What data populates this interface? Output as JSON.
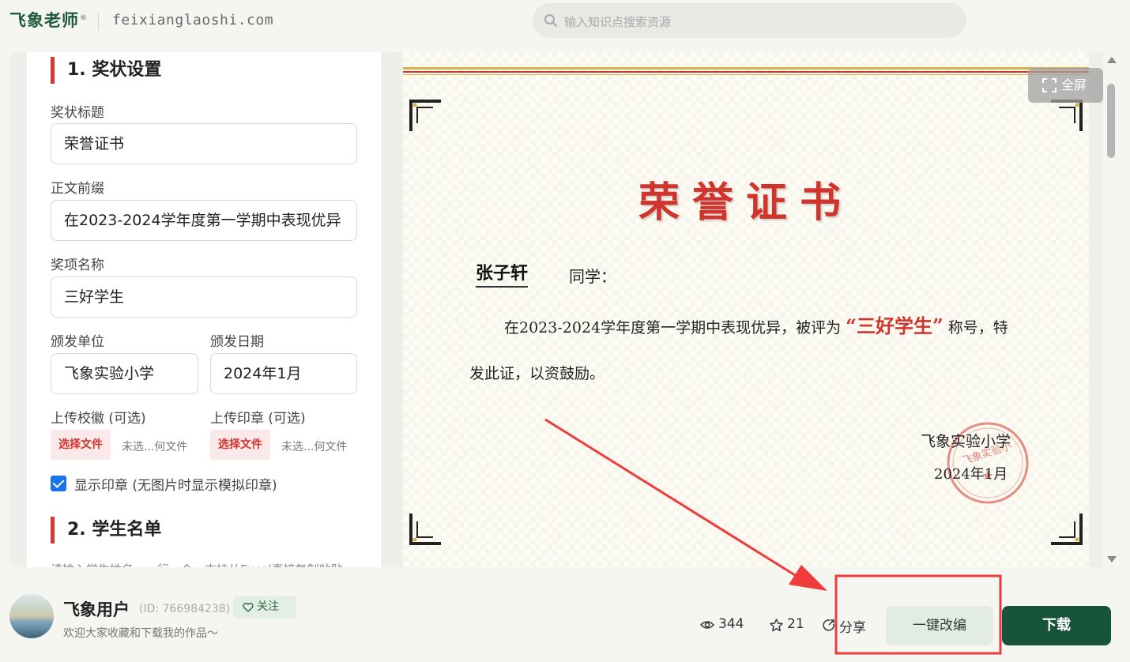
{
  "header": {
    "logo_text": "飞象老师",
    "logo_mark": "®",
    "domain": "feixianglaoshi.com",
    "search_placeholder": "输入知识点搜索资源"
  },
  "form": {
    "section1_title": "1. 奖状设置",
    "title_label": "奖状标题",
    "title_value": "荣誉证书",
    "prefix_label": "正文前缀",
    "prefix_value": "在2023-2024学年度第一学期中表现优异",
    "award_label": "奖项名称",
    "award_value": "三好学生",
    "issuer_label": "颁发单位",
    "issuer_value": "飞象实验小学",
    "date_label": "颁发日期",
    "date_value": "2024年1月",
    "logo_upload_label": "上传校徽 (可选)",
    "seal_upload_label": "上传印章 (可选)",
    "choose_file": "选择文件",
    "no_file": "未选...何文件",
    "show_seal_label": "显示印章 (无图片时显示模拟印章)",
    "show_seal_checked": true,
    "section2_title": "2. 学生名单",
    "student_hint": "请输入学生姓名，一行一个，支持从Excel直接复制粘贴"
  },
  "certificate": {
    "title": "荣誉证书",
    "recipient": "张子轩",
    "recipient_suffix": "同学：",
    "body_before": "在2023-2024学年度第一学期中表现优异，被评为",
    "award": "“三好学生”",
    "body_after": "称号，特发此证，以资鼓励。",
    "issuer": "飞象实验小学",
    "date": "2024年1月",
    "seal_text": "飞象实验小",
    "title_color": "#d0342c"
  },
  "preview_controls": {
    "fullscreen": "全屏"
  },
  "author": {
    "name": "飞象用户",
    "id": "(ID: 766984238)",
    "follow": "关注",
    "bio": "欢迎大家收藏和下载我的作品～"
  },
  "actions": {
    "views": "344",
    "stars": "21",
    "share": "分享",
    "adapt": "一键改编",
    "download": "下载"
  },
  "colors": {
    "brand": "#17533a",
    "accent_red": "#d0342c",
    "annotation": "#ee3b3b"
  }
}
